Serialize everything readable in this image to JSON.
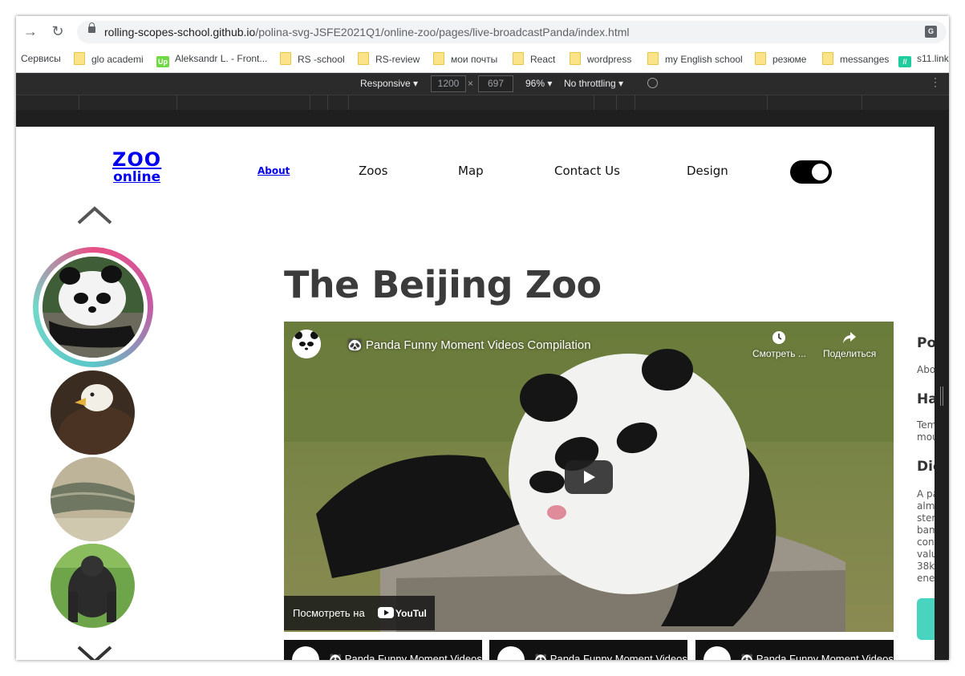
{
  "browser": {
    "url_host": "rolling-scopes-school.github.io",
    "url_path": "/polina-svg-JSFE2021Q1/online-zoo/pages/live-broadcastPanda/index.html",
    "bookmarks": [
      "Сервисы",
      "glo academi",
      "Aleksandr L. - Front...",
      "RS -school",
      "RS-review",
      "мои почты",
      "React",
      "wordpress",
      "my English school",
      "резюме",
      "messanges",
      "s11.link"
    ]
  },
  "devtools": {
    "mode": "Responsive",
    "width": "1200",
    "height": "697",
    "zoom": "96%",
    "throttling": "No throttling"
  },
  "site": {
    "logo_line1": "ZOO",
    "logo_line2": "online",
    "nav": [
      "About",
      "Zoos",
      "Map",
      "Contact Us",
      "Design"
    ],
    "title": "The Beijing Zoo",
    "video": {
      "title": "🐼 Panda Funny Moment Videos Compilation",
      "watch_later": "Смотреть ...",
      "share": "Поделиться",
      "watch_on": "Посмотреть на",
      "youtube": "YouTube"
    },
    "mini_video_title": "🐼 Panda Funny Moment Videos Compilation",
    "sidebar": {
      "h1": "Po",
      "p1": "Abo",
      "h2": "Ha",
      "p2": [
        "Tem",
        "mou"
      ],
      "h3": "Die",
      "p3": [
        "A pa",
        "alm",
        "ster",
        "bam",
        "con",
        "valu",
        "38k",
        "ene"
      ]
    }
  }
}
